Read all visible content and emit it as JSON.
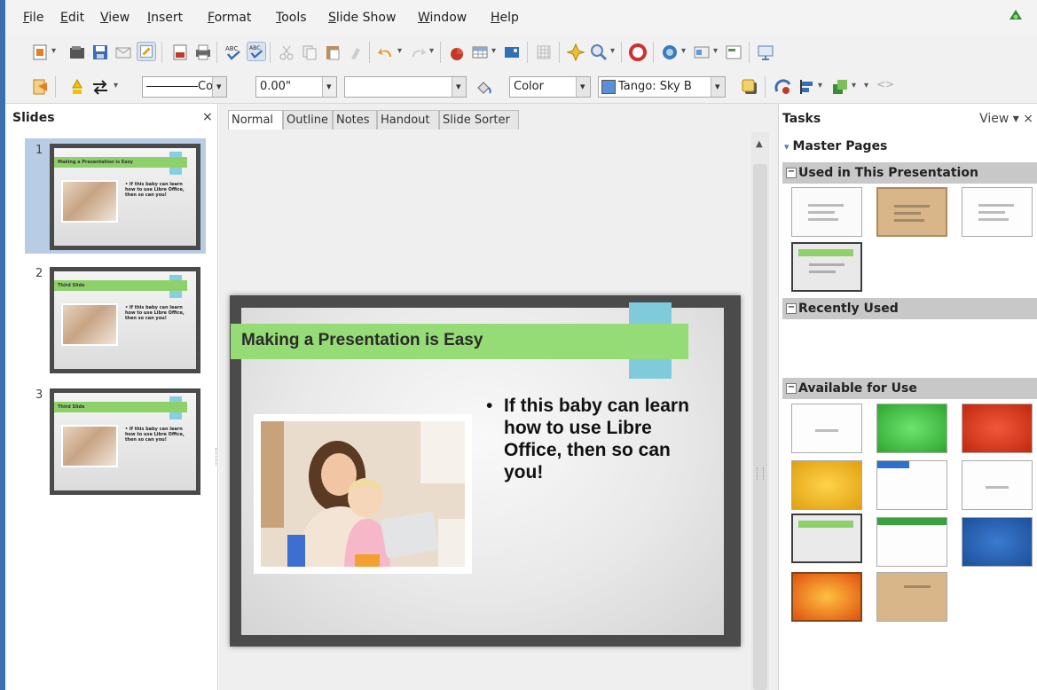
{
  "menu": [
    "File",
    "Edit",
    "View",
    "Insert",
    "Format",
    "Tools",
    "Slide Show",
    "Window",
    "Help"
  ],
  "toolbar2": {
    "line_style": "Co",
    "line_width": "0.00\"",
    "line_color": "",
    "area_style": "Color",
    "area_fill": "Tango: Sky B",
    "area_fill_color": "#5c8fd6"
  },
  "slides_panel": {
    "title": "Slides",
    "close": "×",
    "slides": [
      {
        "number": "1",
        "title": "Making a Presentation is Easy",
        "body": "• If this baby can learn how to use Libre Office, then so can you!"
      },
      {
        "number": "2",
        "title": "Third Slide",
        "body": "• If this baby can learn how to use Libre Office, then so can you!"
      },
      {
        "number": "3",
        "title": "Third Slide",
        "body": "• If this baby can learn how to use Libre Office, then so can you!"
      }
    ]
  },
  "view_tabs": [
    "Normal",
    "Outline",
    "Notes",
    "Handout",
    "Slide Sorter"
  ],
  "slide": {
    "title": "Making a Presentation is Easy",
    "bullet": "•",
    "bullet_text": "If this baby can learn how to use Libre Office, then so can you!"
  },
  "tasks": {
    "title": "Tasks",
    "view": "View ▾ ×",
    "master_pages": "Master Pages",
    "used": "Used in This Presentation",
    "recent": "Recently Used",
    "available": "Available for Use"
  },
  "colors": {
    "title_bar": "#95dc76",
    "accent_tab": "#7fcbdc",
    "slide_frame": "#4b4b4b",
    "selection": "#b9cce6"
  }
}
